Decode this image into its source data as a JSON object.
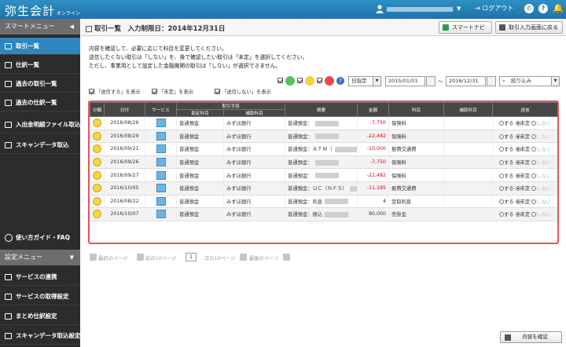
{
  "app": {
    "logo": "弥生会計",
    "logo_sub": "オンライン",
    "logout_label": "ログアウト"
  },
  "sidebar": {
    "smart_menu_label": "スマートメニュー",
    "items": [
      {
        "label": "取引一覧",
        "icon": "list-icon"
      },
      {
        "label": "仕訳一覧",
        "icon": "list-icon"
      },
      {
        "label": "過去の取引一覧",
        "icon": "list-icon"
      },
      {
        "label": "過去の仕訳一覧",
        "icon": "list-icon"
      },
      {
        "label": "入出金明細ファイル取込",
        "icon": "import-icon"
      },
      {
        "label": "スキャンデータ取込",
        "icon": "scan-icon"
      }
    ],
    "help_label": "使い方ガイド・FAQ",
    "settings_menu_label": "設定メニュー",
    "settings_items": [
      {
        "label": "サービスの連携",
        "icon": "link-icon"
      },
      {
        "label": "サービスの取得設定",
        "icon": "settings-icon"
      },
      {
        "label": "まとめ仕訳設定",
        "icon": "tag-icon"
      },
      {
        "label": "スキャンデータ取込設定",
        "icon": "scan-settings-icon"
      }
    ]
  },
  "header": {
    "title": "取引一覧　入力制限日：2014年12月31日",
    "smart_navi_label": "スマートナビ",
    "back_label": "取引入力画面に戻る"
  },
  "instructions": [
    "内容を確認して、必要に応じて科目を変更してください。",
    "送信したくない取引は「しない」を、後で確認したい取引は「未定」を選択してください。",
    "ただし、事業用として設定した金融機関の取引は「しない」が選択できません。"
  ],
  "filters": {
    "date_mode": "日指定",
    "date_from": "2015/01/01",
    "date_sep": "～",
    "date_to": "2016/12/31",
    "narrow_label": "絞り込み"
  },
  "show_options": [
    "「送信する」を表示",
    "「未定」を表示",
    "「送信しない」を表示"
  ],
  "table": {
    "headers": {
      "status": "分類",
      "date": "日付",
      "service": "サービス",
      "means_group": "取引手段",
      "means_account": "勘定科目",
      "means_sub": "補助科目",
      "summary": "摘要",
      "amount": "金額",
      "account": "科目",
      "sub_account": "補助科目",
      "send": "送信"
    },
    "radio_labels": [
      "する",
      "未定",
      "しない"
    ],
    "rows": [
      {
        "date": "2016/08/26",
        "means_account": "普通預金",
        "means_sub": "みずほ銀行",
        "summary": "普通預金：",
        "amount": "-7,750",
        "account": "保険料",
        "selected": 1
      },
      {
        "date": "2016/08/29",
        "means_account": "普通預金",
        "means_sub": "みずほ銀行",
        "summary": "普通預金：",
        "amount": "-22,482",
        "account": "保険料",
        "selected": 1
      },
      {
        "date": "2016/09/21",
        "means_account": "普通預金",
        "means_sub": "みずほ銀行",
        "summary": "普通預金：ＡＴＭ（",
        "amount": "-10,000",
        "account": "振費交通費",
        "selected": 1
      },
      {
        "date": "2016/09/26",
        "means_account": "普通預金",
        "means_sub": "みずほ銀行",
        "summary": "普通預金：",
        "amount": "-7,750",
        "account": "保険料",
        "selected": 1
      },
      {
        "date": "2016/09/27",
        "means_account": "普通預金",
        "means_sub": "みずほ銀行",
        "summary": "普通預金：",
        "amount": "-22,482",
        "account": "保険料",
        "selected": 1
      },
      {
        "date": "2016/10/05",
        "means_account": "普通預金",
        "means_sub": "みずほ銀行",
        "summary": "普通預金：ＵＣ（ＮＦＳ）",
        "amount": "-11,185",
        "account": "振費交通費",
        "selected": 1
      },
      {
        "date": "2016/08/22",
        "means_account": "普通預金",
        "means_sub": "みずほ銀行",
        "summary": "普通預金：利息",
        "amount": "4",
        "account": "受取利息",
        "selected": 1
      },
      {
        "date": "2016/10/07",
        "means_account": "普通預金",
        "means_sub": "みずほ銀行",
        "summary": "普通預金：振込",
        "amount": "80,000",
        "account": "売掛金",
        "selected": 1
      }
    ]
  },
  "pager": {
    "first": "最初のページ",
    "prev10": "前の10ページ",
    "current": "1",
    "next10": "次の10ページ",
    "last": "最後のページ"
  },
  "confirm_label": "内容を確認"
}
